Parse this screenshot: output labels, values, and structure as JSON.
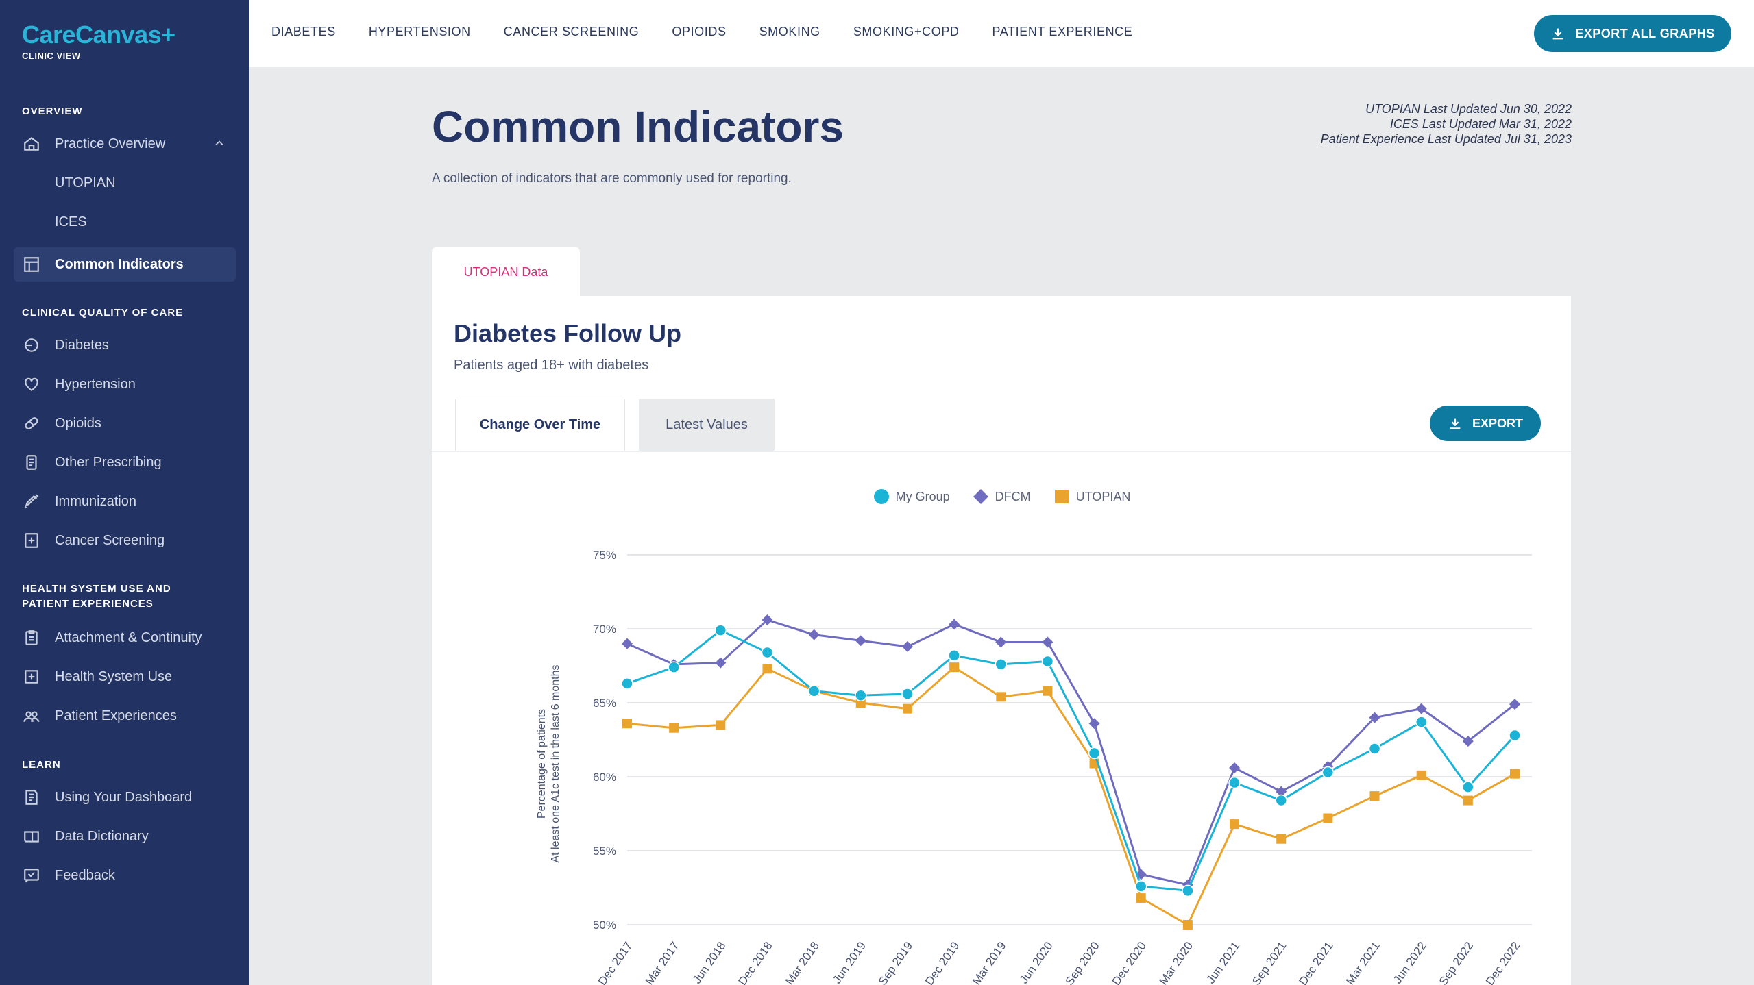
{
  "app": {
    "logo": "CareCanvas+",
    "logo_sub": "CLINIC VIEW"
  },
  "sidebar": {
    "sections": [
      {
        "heading": "OVERVIEW"
      },
      {
        "heading": "CLINICAL QUALITY OF CARE"
      },
      {
        "heading": "HEALTH SYSTEM USE AND PATIENT EXPERIENCES"
      },
      {
        "heading": "LEARN"
      }
    ],
    "items": [
      {
        "label": "Practice Overview",
        "icon": "home-icon"
      },
      {
        "label": "UTOPIAN"
      },
      {
        "label": "ICES"
      },
      {
        "label": "Common Indicators",
        "icon": "grid-icon",
        "active": true
      },
      {
        "label": "Diabetes",
        "icon": "drop-icon"
      },
      {
        "label": "Hypertension",
        "icon": "heart-icon"
      },
      {
        "label": "Opioids",
        "icon": "pill-icon"
      },
      {
        "label": "Other Prescribing",
        "icon": "prescription-icon"
      },
      {
        "label": "Immunization",
        "icon": "syringe-icon"
      },
      {
        "label": "Cancer Screening",
        "icon": "screening-icon"
      },
      {
        "label": "Attachment & Continuity",
        "icon": "clipboard-icon"
      },
      {
        "label": "Health System Use",
        "icon": "hospital-icon"
      },
      {
        "label": "Patient Experiences",
        "icon": "people-icon"
      },
      {
        "label": "Using Your Dashboard",
        "icon": "book-icon"
      },
      {
        "label": "Data Dictionary",
        "icon": "dictionary-icon"
      },
      {
        "label": "Feedback",
        "icon": "feedback-icon"
      }
    ]
  },
  "topnav": {
    "links": [
      "DIABETES",
      "HYPERTENSION",
      "CANCER SCREENING",
      "OPIOIDS",
      "SMOKING",
      "SMOKING+COPD",
      "PATIENT EXPERIENCE"
    ],
    "export_all": "EXPORT ALL GRAPHS"
  },
  "main": {
    "title": "Common Indicators",
    "description": "A collection of indicators that are commonly used for reporting.",
    "updates": [
      "UTOPIAN Last Updated Jun 30, 2022",
      "ICES Last Updated Mar 31, 2022",
      "Patient Experience Last Updated Jul 31, 2023"
    ],
    "data_tab": "UTOPIAN Data",
    "card": {
      "title": "Diabetes Follow Up",
      "subtitle": "Patients aged 18+ with diabetes",
      "tabs": [
        "Change Over Time",
        "Latest Values"
      ],
      "export": "EXPORT"
    }
  },
  "colors": {
    "my_group": "#1bb3d6",
    "dfcm": "#6f6bbf",
    "utopian": "#eaa42e",
    "sidebar": "#223363",
    "accent": "#0e7aa0"
  },
  "chart_data": {
    "type": "line",
    "ylabel": "Percentage of patients At least one A1c test in the last 6 months",
    "yticks": [
      "75%",
      "70%",
      "65%",
      "60%",
      "55%",
      "50%"
    ],
    "ylim": [
      50,
      75
    ],
    "grid": true,
    "legend_position": "top-center",
    "categories": [
      "Dec 2017",
      "Mar 2017",
      "Jun 2018",
      "Dec 2018",
      "Mar 2018",
      "Jun 2019",
      "Sep 2019",
      "Dec 2019",
      "Mar 2019",
      "Jun 2020",
      "Sep 2020",
      "Dec 2020",
      "Mar 2020",
      "Jun 2021",
      "Sep 2021",
      "Dec 2021",
      "Mar 2021",
      "Jun 2022",
      "Sep 2022",
      "Dec 2022"
    ],
    "series": [
      {
        "name": "My Group",
        "marker": "circle",
        "values": [
          66.3,
          67.4,
          69.9,
          68.4,
          65.8,
          65.5,
          65.6,
          68.2,
          67.6,
          67.8,
          61.6,
          52.6,
          52.3,
          59.6,
          58.4,
          60.3,
          61.9,
          63.7,
          59.3,
          62.8
        ]
      },
      {
        "name": "DFCM",
        "marker": "diamond",
        "values": [
          69.0,
          67.6,
          67.7,
          70.6,
          69.6,
          69.2,
          68.8,
          70.3,
          69.1,
          69.1,
          63.6,
          53.4,
          52.7,
          60.6,
          59.0,
          60.7,
          64.0,
          64.6,
          62.4,
          64.9
        ]
      },
      {
        "name": "UTOPIAN",
        "marker": "square",
        "values": [
          63.6,
          63.3,
          63.5,
          67.3,
          65.8,
          65.0,
          64.6,
          67.4,
          65.4,
          65.8,
          60.9,
          51.8,
          50.0,
          56.8,
          55.8,
          57.2,
          58.7,
          60.1,
          58.4,
          60.2
        ]
      }
    ]
  }
}
